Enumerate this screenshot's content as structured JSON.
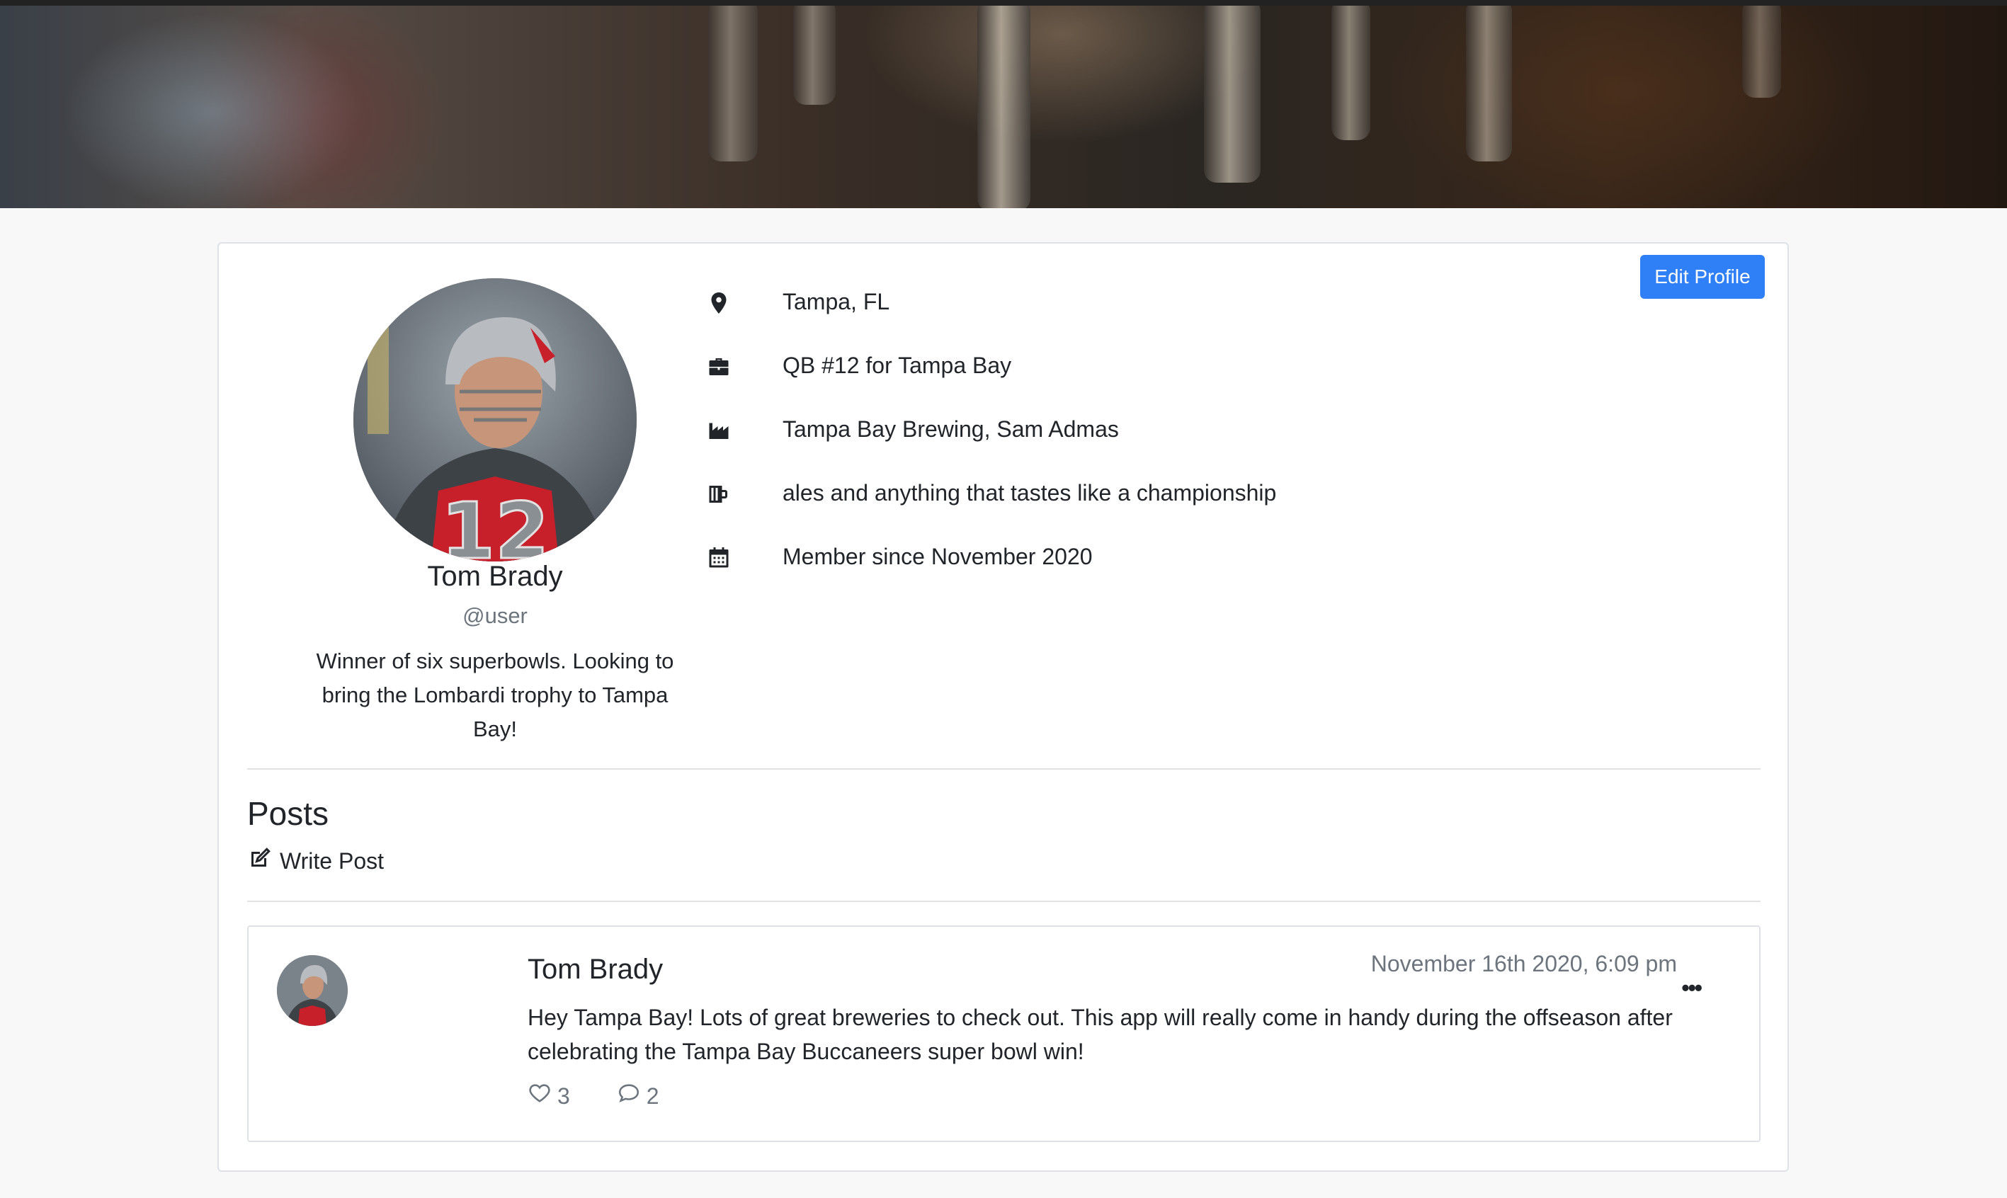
{
  "profile": {
    "name": "Tom Brady",
    "handle": "@user",
    "bio": "Winner of six superbowls. Looking to bring the Lombardi trophy to Tampa Bay!",
    "edit_label": "Edit Profile",
    "accent_color": "#2f7ff6"
  },
  "info": [
    {
      "icon": "location-pin-icon",
      "text": "Tampa, FL"
    },
    {
      "icon": "briefcase-icon",
      "text": "QB #12 for Tampa Bay"
    },
    {
      "icon": "industry-icon",
      "text": "Tampa Bay Brewing, Sam Admas"
    },
    {
      "icon": "beer-mug-icon",
      "text": "ales and anything that tastes like a championship"
    },
    {
      "icon": "calendar-icon",
      "text": "Member since November 2020"
    }
  ],
  "posts_section": {
    "title": "Posts",
    "write_label": "Write Post"
  },
  "posts": [
    {
      "author": "Tom Brady",
      "time": "November 16th 2020, 6:09 pm",
      "more": "•••",
      "body": "Hey Tampa Bay! Lots of great breweries to check out. This app will really come in handy during the offseason after celebrating the Tampa Bay Buccaneers super bowl win!",
      "likes": "3",
      "comments": "2"
    }
  ]
}
